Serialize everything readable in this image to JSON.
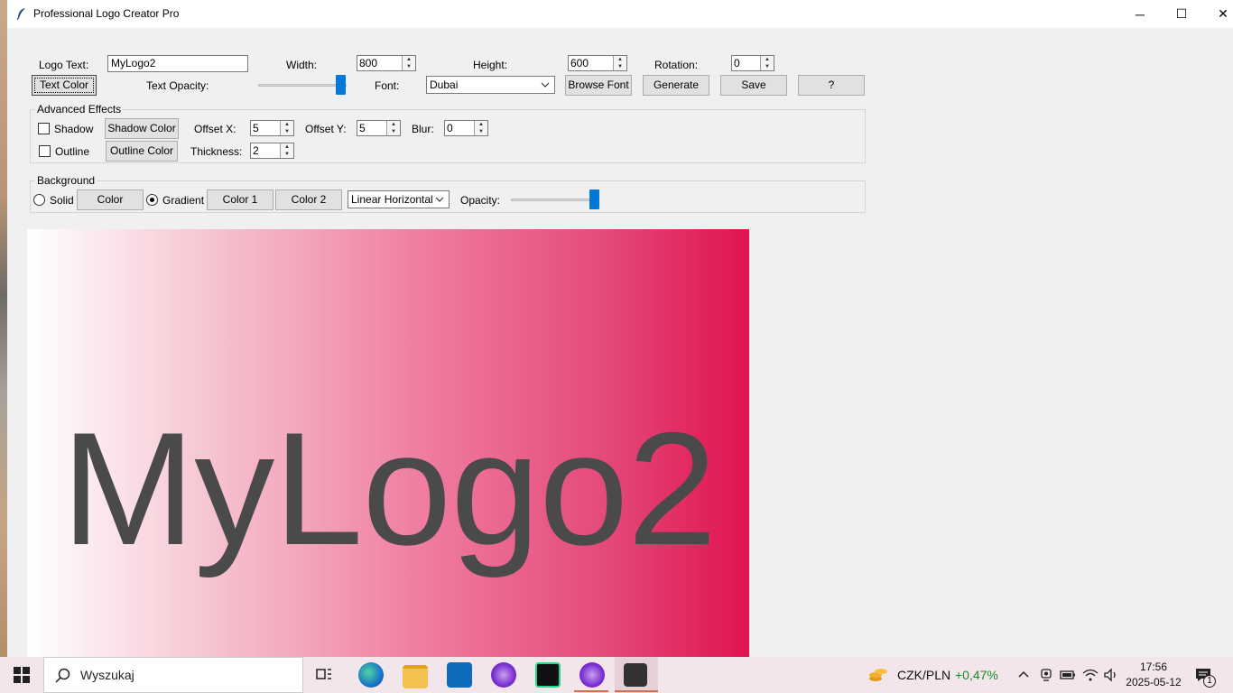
{
  "window": {
    "title": "Professional Logo Creator Pro",
    "minimize": "─",
    "maximize": "☐",
    "close": "✕"
  },
  "row1": {
    "logo_text_label": "Logo Text:",
    "logo_text_value": "MyLogo2",
    "width_label": "Width:",
    "width_value": "800",
    "height_label": "Height:",
    "height_value": "600",
    "rotation_label": "Rotation:",
    "rotation_value": "0"
  },
  "row2": {
    "text_color_button": "Text Color",
    "text_opacity_label": "Text Opacity:",
    "text_opacity_level": 1.0,
    "font_label": "Font:",
    "font_value": "Dubai",
    "browse_font_button": "Browse Font",
    "generate_button": "Generate",
    "save_button": "Save",
    "help_button": "?"
  },
  "advanced": {
    "title": "Advanced Effects",
    "shadow_label": "Shadow",
    "shadow_checked": false,
    "shadow_color_button": "Shadow Color",
    "offset_x_label": "Offset X:",
    "offset_x_value": "5",
    "offset_y_label": "Offset Y:",
    "offset_y_value": "5",
    "blur_label": "Blur:",
    "blur_value": "0",
    "outline_label": "Outline",
    "outline_checked": false,
    "outline_color_button": "Outline Color",
    "thickness_label": "Thickness:",
    "thickness_value": "2"
  },
  "background": {
    "title": "Background",
    "solid_label": "Solid",
    "color_button": "Color",
    "gradient_label": "Gradient",
    "selected": "Gradient",
    "color1_button": "Color 1",
    "color2_button": "Color 2",
    "gradient_type": "Linear Horizontal",
    "opacity_label": "Opacity:",
    "opacity_level": 1.0
  },
  "preview": {
    "text": "MyLogo2",
    "gradient_start": "#ffffff",
    "gradient_end": "#e0134e",
    "text_color": "#4a4a4a"
  },
  "taskbar": {
    "search_placeholder": "Wyszukaj",
    "currency_pair": "CZK/PLN",
    "currency_change": "+0,47%",
    "time": "17:56",
    "date": "2025-05-12",
    "notification_count": "1"
  },
  "colors": {
    "accent": "#0078d7",
    "positive": "#1a8a2a"
  }
}
